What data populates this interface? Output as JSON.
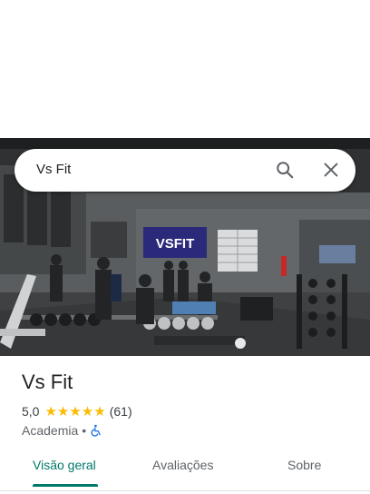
{
  "search": {
    "query": "Vs Fit"
  },
  "photo": {
    "sign_text": "VSFIT"
  },
  "place": {
    "name": "Vs Fit",
    "rating": "5,0",
    "stars": "★★★★★",
    "review_count": "(61)",
    "category": "Academia",
    "separator": "•",
    "wheelchair_accessible": true
  },
  "tabs": [
    {
      "label": "Visão geral",
      "active": true
    },
    {
      "label": "Avaliações",
      "active": false
    },
    {
      "label": "Sobre",
      "active": false
    }
  ],
  "colors": {
    "accent": "#00796b",
    "star": "#fbbc04",
    "sign_bg": "#2b2a7a"
  },
  "icons": [
    "search-icon",
    "close-icon",
    "wheelchair-icon"
  ]
}
